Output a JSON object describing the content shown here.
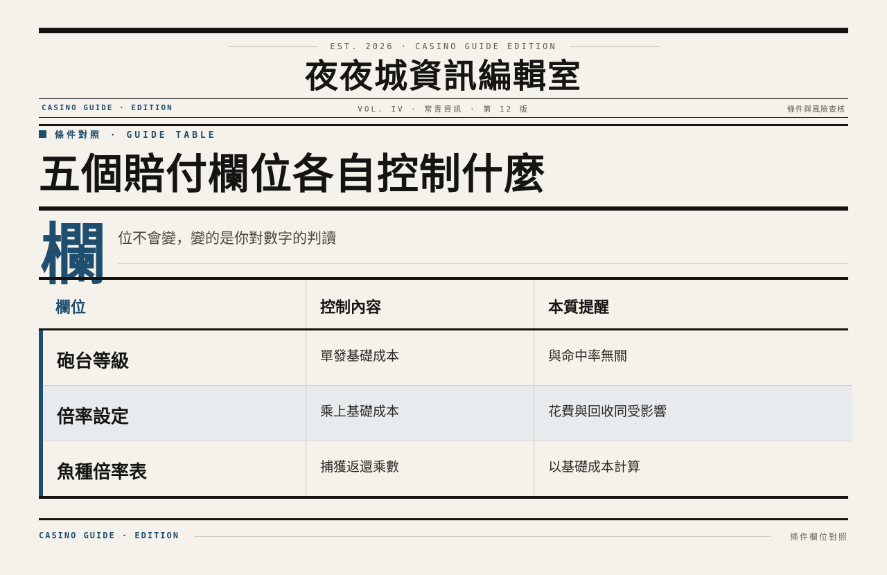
{
  "header": {
    "est_text": "EST. 2026 · CASINO GUIDE EDITION",
    "masthead": "夜夜城資訊編輯室",
    "edition_label": "CASINO GUIDE · EDITION",
    "volume_text": "VOL. IV · 常青資訊 · 第 12 版",
    "right_label": "條件與風險查核"
  },
  "article": {
    "kicker": "條件對照 · GUIDE TABLE",
    "headline": "五個賠付欄位各自控制什麼",
    "dropcap": "欄",
    "deck": "位不會變，變的是你對數字的判讀"
  },
  "table": {
    "headers": [
      "欄位",
      "控制內容",
      "本質提醒"
    ],
    "rows": [
      {
        "field": "砲台等級",
        "control": "單發基礎成本",
        "note": "與命中率無關"
      },
      {
        "field": "倍率設定",
        "control": "乘上基礎成本",
        "note": "花費與回收同受影響"
      },
      {
        "field": "魚種倍率表",
        "control": "捕獲返還乘數",
        "note": "以基礎成本計算"
      }
    ]
  },
  "footer": {
    "left": "CASINO GUIDE · EDITION",
    "right": "條件欄位對照"
  }
}
